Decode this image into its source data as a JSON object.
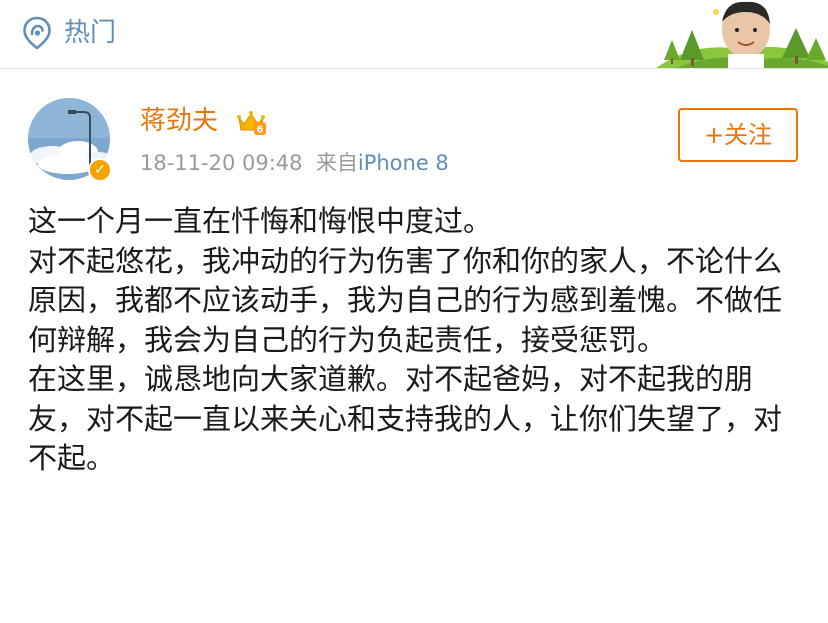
{
  "header": {
    "hot_label": "热门",
    "hot_icon": "location-pin-icon",
    "accent_color": "#5f8fb8"
  },
  "post": {
    "author": "蒋劲夫",
    "author_color": "#e8760a",
    "vip_badge_icon": "crown-vip-icon",
    "verified_icon": "verified-badge-icon",
    "timestamp": "18-11-20 09:48",
    "source_prefix": "来自",
    "source": "iPhone 8",
    "follow_label": "+关注",
    "paragraphs": [
      "这一个月一直在忏悔和悔恨中度过。",
      "对不起悠花，我冲动的行为伤害了你和你的家人，不论什么原因，我都不应该动手，我为自己的行为感到羞愧。不做任何辩解，我会为自己的行为负起责任，接受惩罚。",
      "在这里，诚恳地向大家道歉。对不起爸妈，对不起我的朋友，对不起一直以来关心和支持我的人，让你们失望了，对不起。"
    ]
  }
}
